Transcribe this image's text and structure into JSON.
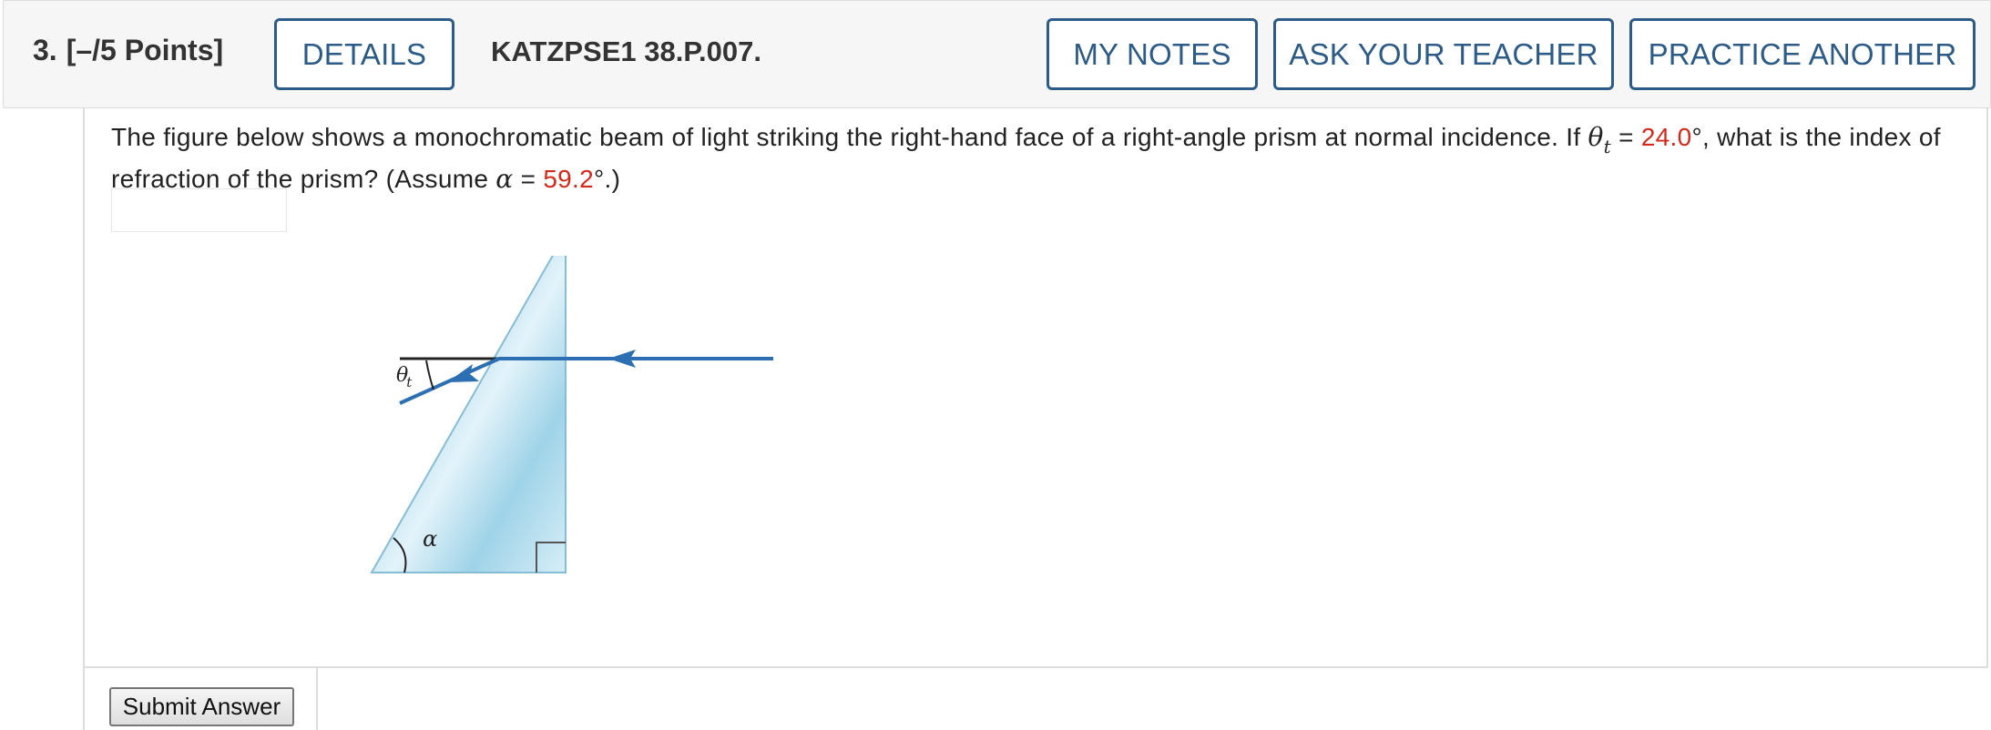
{
  "question": {
    "number": "3.",
    "points": "[–/5 Points]",
    "problem_id": "KATZPSE1 38.P.007."
  },
  "toolbar": {
    "details_label": "DETAILS",
    "my_notes_label": "MY NOTES",
    "ask_teacher_label": "ASK YOUR TEACHER",
    "practice_another_label": "PRACTICE ANOTHER"
  },
  "prompt": {
    "text_1": "The figure below shows a monochromatic beam of light striking the right-hand face of a right-angle prism at normal incidence. If ",
    "theta_symbol": "θ",
    "theta_subscript": "t",
    "equals_1": " = ",
    "theta_value": "24.0",
    "degree_1": "°,",
    "text_2": "  what is the index of refraction of the prism? (Assume ",
    "alpha_symbol": "α",
    "equals_2": " = ",
    "alpha_value": "59.2",
    "text_3": "°.)"
  },
  "answer": {
    "value": ""
  },
  "figure": {
    "theta_label": "θ",
    "theta_label_sub": "t",
    "alpha_label": "α",
    "colors": {
      "prism_light": "#dff2f9",
      "prism_mid": "#9ed3e8",
      "prism_edge": "#7fb8d2",
      "beam": "#2c6fb3",
      "normal_line": "#222222"
    }
  },
  "submit": {
    "label": "Submit Answer"
  },
  "colors": {
    "accent": "#2c5b87",
    "value_red": "#d4291a"
  }
}
